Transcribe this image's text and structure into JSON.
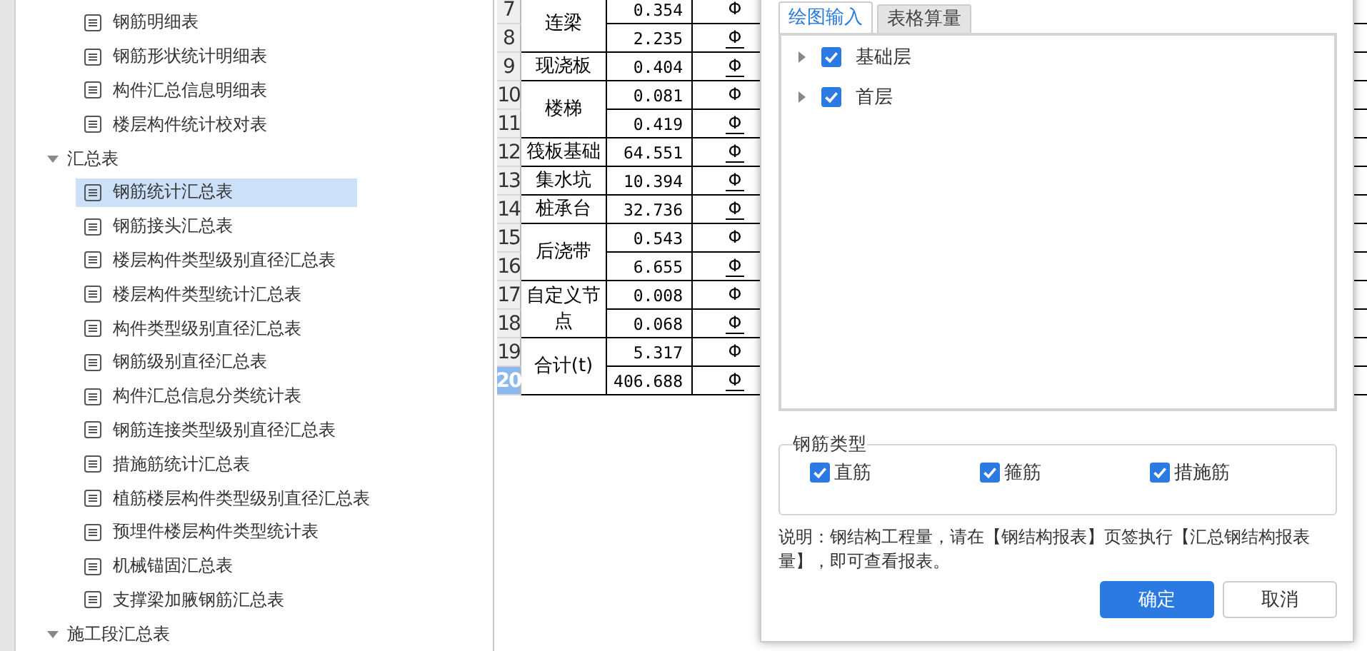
{
  "tree": [
    {
      "kind": "report",
      "label": "钢筋明细表",
      "selected": false
    },
    {
      "kind": "report",
      "label": "钢筋形状统计明细表",
      "selected": false
    },
    {
      "kind": "report",
      "label": "构件汇总信息明细表",
      "selected": false
    },
    {
      "kind": "report",
      "label": "楼层构件统计校对表",
      "selected": false
    },
    {
      "kind": "group",
      "label": "汇总表",
      "expanded": true,
      "children": [
        {
          "kind": "report",
          "label": "钢筋统计汇总表",
          "selected": true
        },
        {
          "kind": "report",
          "label": "钢筋接头汇总表",
          "selected": false
        },
        {
          "kind": "report",
          "label": "楼层构件类型级别直径汇总表",
          "selected": false
        },
        {
          "kind": "report",
          "label": "楼层构件类型统计汇总表",
          "selected": false
        },
        {
          "kind": "report",
          "label": "构件类型级别直径汇总表",
          "selected": false
        },
        {
          "kind": "report",
          "label": "钢筋级别直径汇总表",
          "selected": false
        },
        {
          "kind": "report",
          "label": "构件汇总信息分类统计表",
          "selected": false
        },
        {
          "kind": "report",
          "label": "钢筋连接类型级别直径汇总表",
          "selected": false
        },
        {
          "kind": "report",
          "label": "措施筋统计汇总表",
          "selected": false
        },
        {
          "kind": "report",
          "label": "植筋楼层构件类型级别直径汇总表",
          "selected": false
        },
        {
          "kind": "report",
          "label": "预埋件楼层构件类型统计表",
          "selected": false
        },
        {
          "kind": "report",
          "label": "机械锚固汇总表",
          "selected": false
        },
        {
          "kind": "report",
          "label": "支撑梁加腋钢筋汇总表",
          "selected": false
        }
      ]
    },
    {
      "kind": "group",
      "label": "施工段汇总表",
      "expanded": true
    }
  ],
  "table": {
    "groups": [
      {
        "name": "连梁",
        "rows": [
          {
            "row": "7",
            "value": "0.354",
            "symbol": "Φ",
            "kind": "plain",
            "selected": false
          },
          {
            "row": "8",
            "value": "2.235",
            "symbol": "Φ",
            "kind": "ribbed",
            "selected": false
          }
        ]
      },
      {
        "name": "现浇板",
        "rows": [
          {
            "row": "9",
            "value": "0.404",
            "symbol": "Φ",
            "kind": "ribbed",
            "selected": false
          }
        ]
      },
      {
        "name": "楼梯",
        "rows": [
          {
            "row": "10",
            "value": "0.081",
            "symbol": "Φ",
            "kind": "plain",
            "selected": false
          },
          {
            "row": "11",
            "value": "0.419",
            "symbol": "Φ",
            "kind": "ribbed",
            "selected": false
          }
        ]
      },
      {
        "name": "筏板基础",
        "rows": [
          {
            "row": "12",
            "value": "64.551",
            "symbol": "Φ",
            "kind": "ribbed",
            "selected": false
          }
        ]
      },
      {
        "name": "集水坑",
        "rows": [
          {
            "row": "13",
            "value": "10.394",
            "symbol": "Φ",
            "kind": "ribbed",
            "selected": false
          }
        ]
      },
      {
        "name": "桩承台",
        "rows": [
          {
            "row": "14",
            "value": "32.736",
            "symbol": "Φ",
            "kind": "ribbed",
            "selected": false
          }
        ]
      },
      {
        "name": "后浇带",
        "rows": [
          {
            "row": "15",
            "value": "0.543",
            "symbol": "Φ",
            "kind": "plain",
            "selected": false
          },
          {
            "row": "16",
            "value": "6.655",
            "symbol": "Φ",
            "kind": "ribbed",
            "selected": false
          }
        ]
      },
      {
        "name": "自定义节点",
        "rows": [
          {
            "row": "17",
            "value": "0.008",
            "symbol": "Φ",
            "kind": "plain",
            "selected": false
          },
          {
            "row": "18",
            "value": "0.068",
            "symbol": "Φ",
            "kind": "ribbed",
            "selected": false
          }
        ]
      },
      {
        "name": "合计(t)",
        "rows": [
          {
            "row": "19",
            "value": "5.317",
            "symbol": "Φ",
            "kind": "plain",
            "selected": false
          },
          {
            "row": "20",
            "value": "406.688",
            "symbol": "Φ",
            "kind": "ribbed",
            "selected": true
          }
        ]
      }
    ]
  },
  "dialog": {
    "tabs": [
      {
        "label": "绘图输入",
        "selected": true
      },
      {
        "label": "表格算量",
        "selected": false
      }
    ],
    "floors": [
      {
        "label": "基础层",
        "checked": true,
        "expanded": false
      },
      {
        "label": "首层",
        "checked": true,
        "expanded": false
      }
    ],
    "rebar_types": {
      "title": "钢筋类型",
      "options": [
        {
          "label": "直筋",
          "checked": true
        },
        {
          "label": "箍筋",
          "checked": true
        },
        {
          "label": "措施筋",
          "checked": true
        }
      ]
    },
    "note": "说明：钢结构工程量，请在【钢结构报表】页签执行【汇总钢结构报表量】，即可查看报表。",
    "buttons": [
      {
        "label": "确定",
        "kind": "primary"
      },
      {
        "label": "取消",
        "kind": "default"
      }
    ]
  }
}
